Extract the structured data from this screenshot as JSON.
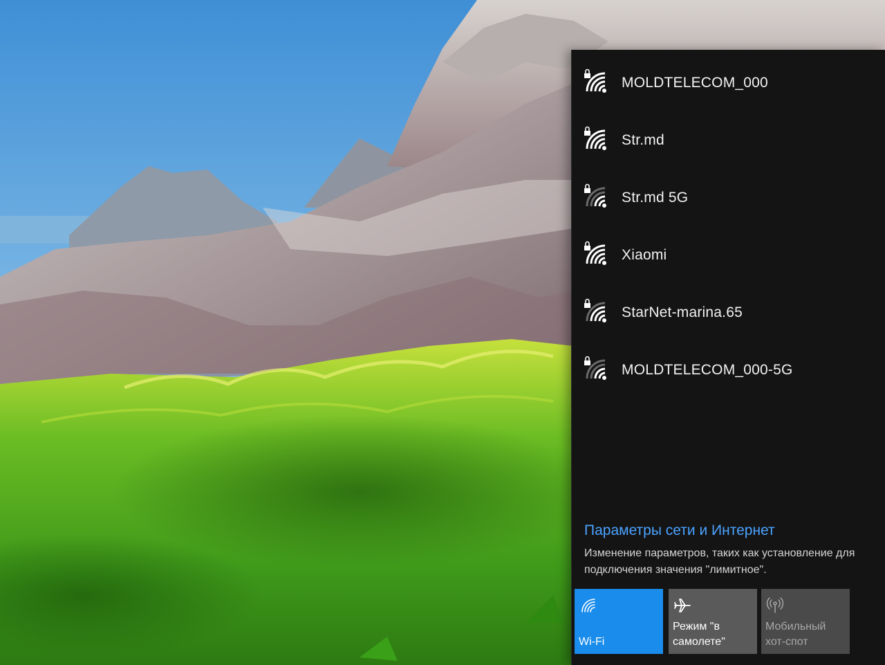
{
  "networks": [
    {
      "name": "MOLDTELECOM_000",
      "signal": 4,
      "secured": true
    },
    {
      "name": "Str.md",
      "signal": 4,
      "secured": true
    },
    {
      "name": "Str.md 5G",
      "signal": 2,
      "secured": true
    },
    {
      "name": "Xiaomi",
      "signal": 4,
      "secured": true
    },
    {
      "name": "StarNet-marina.65",
      "signal": 3,
      "secured": true
    },
    {
      "name": "MOLDTELECOM_000-5G",
      "signal": 2,
      "secured": true
    }
  ],
  "settings": {
    "link_label": "Параметры сети и Интернет",
    "description_line1": "Изменение параметров, таких как установление для",
    "description_line2": "подключения значения \"лимитное\"."
  },
  "quick_actions": {
    "wifi": {
      "label": "Wi-Fi",
      "icon": "wifi-icon",
      "active": true
    },
    "airplane": {
      "label": "Режим \"в самолете\"",
      "icon": "airplane-icon",
      "active": false
    },
    "hotspot": {
      "label": "Мобильный хот-спот",
      "icon": "hotspot-icon",
      "active": false,
      "disabled": true
    }
  },
  "colors": {
    "flyout_background": "#141414",
    "accent": "#1a8ceb",
    "link": "#4aa3ff"
  }
}
